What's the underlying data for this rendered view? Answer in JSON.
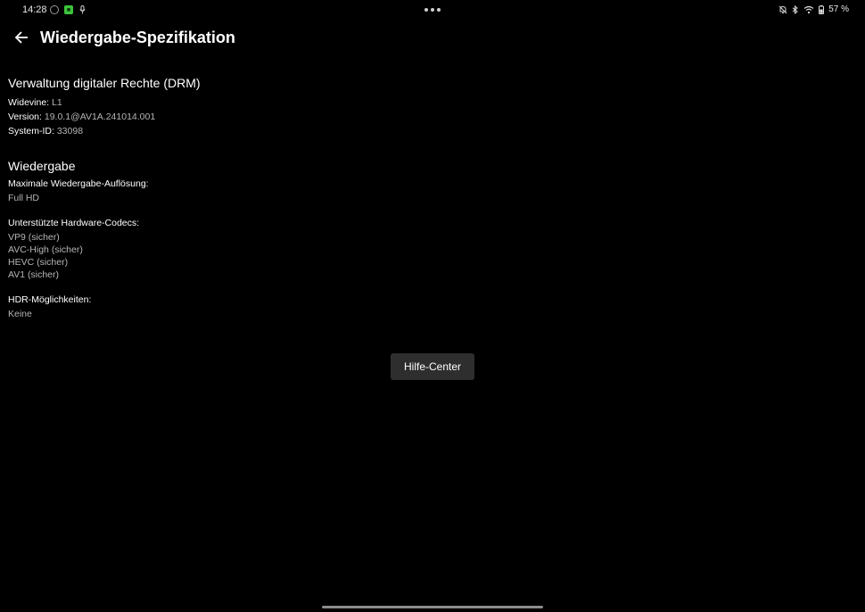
{
  "status_bar": {
    "time": "14:28",
    "battery": "57 %",
    "app_badge_color": "#3cc43c"
  },
  "header": {
    "title": "Wiedergabe-Spezifikation"
  },
  "drm": {
    "title": "Verwaltung digitaler Rechte (DRM)",
    "items": [
      {
        "key": "Widevine:",
        "value": "L1"
      },
      {
        "key": "Version:",
        "value": "19.0.1@AV1A.241014.001"
      },
      {
        "key": "System-ID:",
        "value": "33098"
      }
    ]
  },
  "playback": {
    "title": "Wiedergabe",
    "max_resolution_label": "Maximale Wiedergabe-Auflösung:",
    "max_resolution_value": "Full HD",
    "codecs_label": "Unterstützte Hardware-Codecs:",
    "codecs": [
      "VP9 (sicher)",
      "AVC-High (sicher)",
      "HEVC (sicher)",
      "AV1 (sicher)"
    ],
    "hdr_label": "HDR-Möglichkeiten:",
    "hdr_value": "Keine"
  },
  "help_button_label": "Hilfe-Center"
}
